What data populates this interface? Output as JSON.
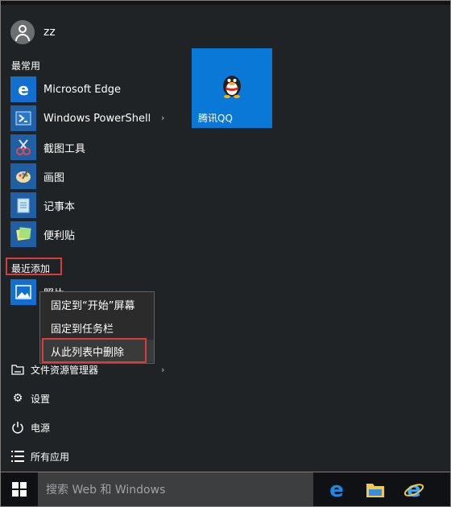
{
  "user": {
    "name": "zz"
  },
  "sections": {
    "most_used": "最常用",
    "recently_added": "最近添加"
  },
  "apps": [
    {
      "label": "Microsoft Edge",
      "icon": "edge-icon",
      "has_submenu": false
    },
    {
      "label": "Windows PowerShell",
      "icon": "powershell-icon",
      "has_submenu": true
    },
    {
      "label": "截图工具",
      "icon": "snipping-tool-icon",
      "has_submenu": false
    },
    {
      "label": "画图",
      "icon": "paint-icon",
      "has_submenu": false
    },
    {
      "label": "记事本",
      "icon": "notepad-icon",
      "has_submenu": false
    },
    {
      "label": "便利贴",
      "icon": "sticky-notes-icon",
      "has_submenu": false
    }
  ],
  "recent_app": {
    "label": "照片",
    "icon": "photos-icon"
  },
  "tiles": [
    {
      "label": "腾讯QQ",
      "icon": "qq-penguin-icon",
      "color": "#0a78d7"
    }
  ],
  "context_menu": {
    "items": [
      "固定到“开始”屏幕",
      "固定到任务栏",
      "从此列表中删除"
    ],
    "highlighted_index": 2
  },
  "bottom_items": [
    {
      "label": "文件资源管理器",
      "icon": "file-explorer-icon",
      "has_submenu": true
    },
    {
      "label": "设置",
      "icon": "gear-icon",
      "has_submenu": false
    },
    {
      "label": "电源",
      "icon": "power-icon",
      "has_submenu": false
    },
    {
      "label": "所有应用",
      "icon": "all-apps-icon",
      "has_submenu": false
    }
  ],
  "taskbar": {
    "search_placeholder": "搜索 Web 和 Windows",
    "pinned": [
      "edge-icon",
      "file-explorer-icon",
      "internet-explorer-icon"
    ]
  },
  "colors": {
    "accent": "#0a78d7",
    "highlight_border": "#d73d3d",
    "menu_bg": "#1f2326"
  }
}
